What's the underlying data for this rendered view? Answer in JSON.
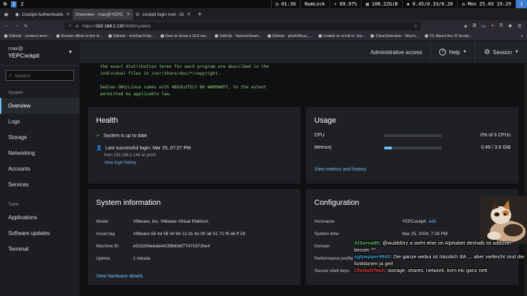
{
  "topbar": {
    "workspaces": [
      "1",
      "2"
    ],
    "active_workspace": "1",
    "stats": [
      "01:30",
      "NumLock",
      "89.97%",
      "100.22GiB",
      "0.45/0.33/0.20",
      "Mon 25.03 19:29"
    ]
  },
  "browser": {
    "tabs": [
      {
        "label": "Cockpit Authentication"
      },
      {
        "label": "Overview - max@YEPCockpit"
      },
      {
        "label": "cockpit login root - Google"
      }
    ],
    "url": {
      "prefix": "https://",
      "host": "192.168.2.130",
      "path": ":9090/system"
    },
    "bookmarks": [
      "GitHub - contour-term...",
      "Arrows offset to the le...",
      "GitHub - mrichar1/clip...",
      "How to show a GUI me...",
      "GitHub - Sweets/tiram...",
      "GitHub - phuhl/linux_...",
      "Unable to scroll in `les...",
      "ClearSelection - Wez's...",
      "TIL About the i3 Scratc..."
    ]
  },
  "sidebar": {
    "user": "max@",
    "host": "YEPCockpit",
    "search_placeholder": "Search",
    "section_system": "System",
    "items_system": [
      "Overview",
      "Logs",
      "Storage",
      "Networking",
      "Accounts",
      "Services"
    ],
    "section_tools": "Tools",
    "items_tools": [
      "Applications",
      "Software updates",
      "Terminal"
    ]
  },
  "header": {
    "admin": "Administrative access",
    "help": "Help",
    "session": "Session"
  },
  "motd": {
    "line1": "the exact distribution terms for each program are described in the",
    "line2": "individual files in /usr/share/doc/*/copyright.",
    "line3": "Debian GNU/Linux comes with ABSOLUTELY NO WARRANTY, to the extent",
    "line4": "permitted by applicable law."
  },
  "health": {
    "title": "Health",
    "status": "System is up to date",
    "login": "Last successful login: Mar 25, 07:27 PM",
    "login_from": "from 192.168.2.146 on pts/0",
    "history_link": "View login history"
  },
  "usage": {
    "title": "Usage",
    "cpu_label": "CPU",
    "cpu_value": "0% of 3 CPUs",
    "cpu_fraction": 0.0,
    "memory_label": "Memory",
    "memory_value": "0.49 / 3.8 GiB",
    "memory_fraction": 0.13,
    "metrics_link": "View metrics and history"
  },
  "sysinfo": {
    "title": "System information",
    "rows": [
      {
        "k": "Model",
        "v": "VMware, Inc. VMware Virtual Platform"
      },
      {
        "k": "Asset tag",
        "v": "VMware-56 4d 59 34 6b 13 d1 6c-00 a6 51 72 f6 a6 ff 29"
      },
      {
        "k": "Machine ID",
        "v": "e023284eeda4425fb63df77471972be4"
      },
      {
        "k": "Uptime",
        "v": "1 minute"
      }
    ],
    "link": "View hardware details"
  },
  "config": {
    "title": "Configuration",
    "hostname_k": "Hostname",
    "hostname_v": "YEPCockpit",
    "edit": "edit",
    "systime_k": "System time",
    "systime_v": "Mar 25, 2024, 7:29 PM",
    "domain_k": "Domain",
    "perf_k": "Performance profile",
    "ssh_k": "Secure shell keys"
  },
  "chat": [
    {
      "user": "AlSorna95",
      "msg": ": @wubbl0rz a steht eher im Alphabet deshalb ist adduser besser ^^"
    },
    {
      "user": "sgtpepper9900",
      "msg": ": Die ganze webui ist hässlich tbh ... aber vielleicht sind die funktionen ja geil"
    },
    {
      "user": "ChrischTech",
      "msg": ": storage, shares, network, kvm etc ganz nett"
    }
  ]
}
